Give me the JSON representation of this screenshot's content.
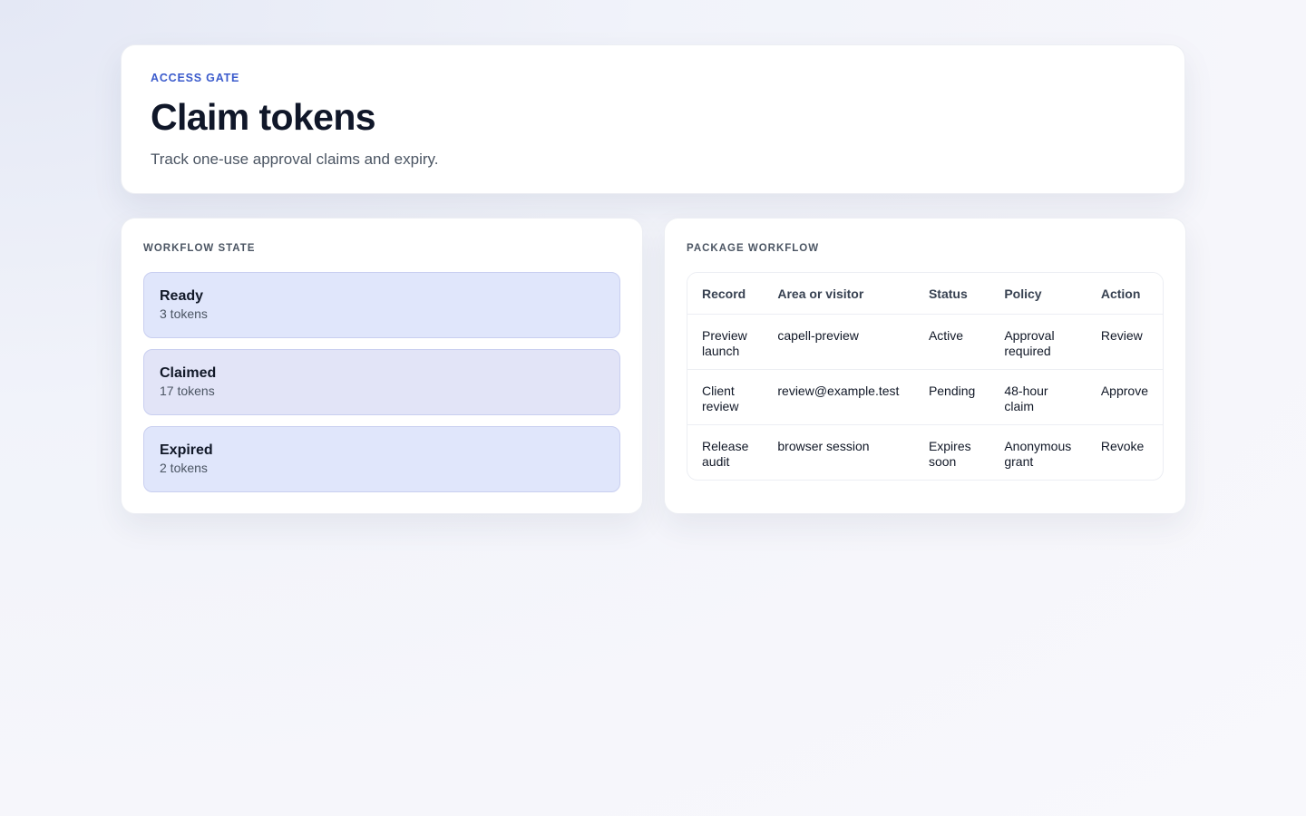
{
  "header": {
    "eyebrow": "ACCESS GATE",
    "title": "Claim tokens",
    "subtitle": "Track one-use approval claims and expiry."
  },
  "workflow_state": {
    "title": "WORKFLOW STATE",
    "items": [
      {
        "name": "Ready",
        "count": "3 tokens"
      },
      {
        "name": "Claimed",
        "count": "17 tokens"
      },
      {
        "name": "Expired",
        "count": "2 tokens"
      }
    ]
  },
  "package_workflow": {
    "title": "PACKAGE WORKFLOW",
    "columns": [
      "Record",
      "Area or visitor",
      "Status",
      "Policy",
      "Action"
    ],
    "rows": [
      {
        "record": "Preview launch",
        "area": "capell-preview",
        "status": "Active",
        "policy": "Approval required",
        "action": "Review"
      },
      {
        "record": "Client review",
        "area": "review@example.test",
        "status": "Pending",
        "policy": "48-hour claim",
        "action": "Approve"
      },
      {
        "record": "Release audit",
        "area": "browser session",
        "status": "Expires soon",
        "policy": "Anonymous grant",
        "action": "Revoke"
      }
    ]
  },
  "colors": {
    "accent": "#3b5bcc",
    "state_card_bg": "#e0e6fb",
    "state_card_border": "#c9cff0"
  }
}
